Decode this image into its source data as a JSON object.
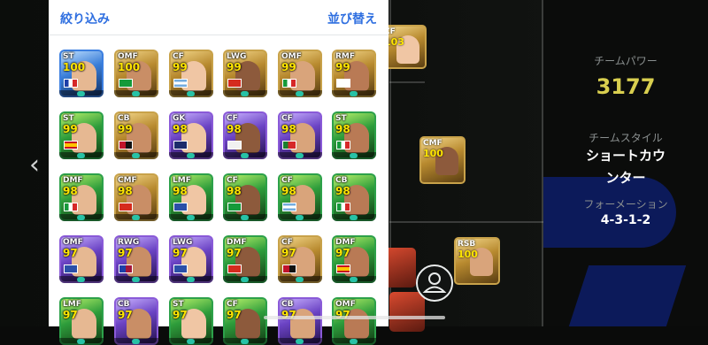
{
  "list_header": {
    "filter_label": "絞り込み",
    "sort_label": "並び替え"
  },
  "team_panel": {
    "power_label": "チームパワー",
    "power_value": "3177",
    "style_label": "チームスタイル",
    "style_value_line1": "ショートカウ",
    "style_value_line2": "ンター",
    "formation_label": "フォーメーション",
    "formation_value": "4-3-1-2"
  },
  "side_nav": {
    "left_chevron": "‹"
  },
  "cards": [
    {
      "pos": "ST",
      "rating": "100",
      "theme": "blue",
      "flag": "france"
    },
    {
      "pos": "OMF",
      "rating": "100",
      "theme": "gold",
      "flag": "brazil"
    },
    {
      "pos": "CF",
      "rating": "99",
      "theme": "gold",
      "flag": "argentina"
    },
    {
      "pos": "LWG",
      "rating": "99",
      "theme": "gold",
      "flag": "arsenal"
    },
    {
      "pos": "OMF",
      "rating": "99",
      "theme": "gold",
      "flag": "italy"
    },
    {
      "pos": "RMF",
      "rating": "99",
      "theme": "gold",
      "flag": "england"
    },
    {
      "pos": "ST",
      "rating": "99",
      "theme": "green",
      "flag": "spain"
    },
    {
      "pos": "CB",
      "rating": "99",
      "theme": "gold",
      "flag": "milan"
    },
    {
      "pos": "GK",
      "rating": "98",
      "theme": "purple",
      "flag": "psg"
    },
    {
      "pos": "CF",
      "rating": "98",
      "theme": "purple",
      "flag": "madrid"
    },
    {
      "pos": "CF",
      "rating": "98",
      "theme": "purple",
      "flag": "portugal"
    },
    {
      "pos": "ST",
      "rating": "98",
      "theme": "green",
      "flag": "italy"
    },
    {
      "pos": "DMF",
      "rating": "98",
      "theme": "green",
      "flag": "italy"
    },
    {
      "pos": "CMF",
      "rating": "98",
      "theme": "gold",
      "flag": "manutd"
    },
    {
      "pos": "LMF",
      "rating": "98",
      "theme": "green",
      "flag": "club"
    },
    {
      "pos": "CF",
      "rating": "98",
      "theme": "green",
      "flag": "brazil"
    },
    {
      "pos": "CF",
      "rating": "98",
      "theme": "green",
      "flag": "argentina"
    },
    {
      "pos": "CB",
      "rating": "98",
      "theme": "green",
      "flag": "italy"
    },
    {
      "pos": "OMF",
      "rating": "97",
      "theme": "purple",
      "flag": "club"
    },
    {
      "pos": "RWG",
      "rating": "97",
      "theme": "purple",
      "flag": "barca"
    },
    {
      "pos": "LWG",
      "rating": "97",
      "theme": "purple",
      "flag": "club"
    },
    {
      "pos": "DMF",
      "rating": "97",
      "theme": "green",
      "flag": "manutd"
    },
    {
      "pos": "CF",
      "rating": "97",
      "theme": "gold",
      "flag": "milan"
    },
    {
      "pos": "DMF",
      "rating": "97",
      "theme": "green",
      "flag": "spain"
    },
    {
      "pos": "LMF",
      "rating": "97",
      "theme": "green",
      "flag": "none"
    },
    {
      "pos": "CB",
      "rating": "97",
      "theme": "purple",
      "flag": "none"
    },
    {
      "pos": "ST",
      "rating": "97",
      "theme": "green",
      "flag": "none"
    },
    {
      "pos": "CF",
      "rating": "97",
      "theme": "green",
      "flag": "none"
    },
    {
      "pos": "CB",
      "rating": "97",
      "theme": "purple",
      "flag": "none"
    },
    {
      "pos": "OMF",
      "rating": "97",
      "theme": "green",
      "flag": "none"
    }
  ],
  "pitch_cards": [
    {
      "pos": "CF",
      "rating": "103",
      "theme": "gold"
    },
    {
      "pos": "CMF",
      "rating": "100",
      "theme": "gold"
    },
    {
      "pos": "RSB",
      "rating": "100",
      "theme": "gold"
    }
  ],
  "colors": {
    "accent_link": "#2f6fe0",
    "rating_yellow": "#ffe600",
    "team_power": "#d9cf4f"
  }
}
